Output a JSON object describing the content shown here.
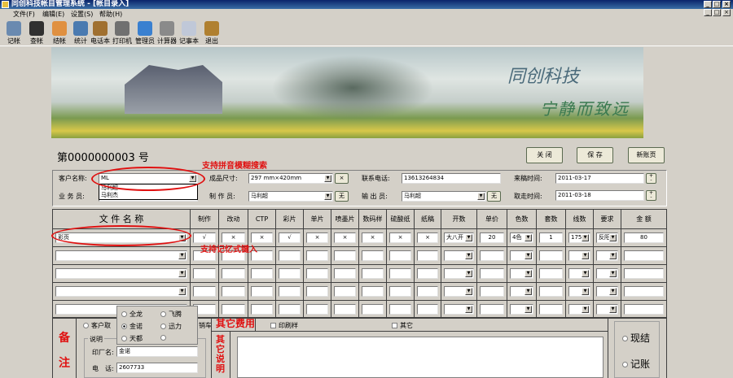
{
  "window": {
    "title": "同创科技帐目管理系统 - [帐目录入]"
  },
  "menu": [
    "文件(F)",
    "编辑(E)",
    "设置(S)",
    "帮助(H)"
  ],
  "toolbar": [
    {
      "label": "记帐",
      "icon": "ledger-icon",
      "color": "#6a8ab0"
    },
    {
      "label": "查帐",
      "icon": "search-icon",
      "color": "#303030"
    },
    {
      "label": "结帐",
      "icon": "checkout-icon",
      "color": "#e09040"
    },
    {
      "label": "统计",
      "icon": "tools-icon",
      "color": "#4a7ab0"
    },
    {
      "label": "电话本",
      "icon": "phonebook-icon",
      "color": "#a07030"
    },
    {
      "label": "打印机",
      "icon": "printer-icon",
      "color": "#707070"
    },
    {
      "label": "管理员",
      "icon": "users-icon",
      "color": "#3a80d0"
    },
    {
      "label": "计算器",
      "icon": "calculator-icon",
      "color": "#8a8a8a"
    },
    {
      "label": "记事本",
      "icon": "notepad-icon",
      "color": "#c0c8d8"
    },
    {
      "label": "退出",
      "icon": "exit-icon",
      "color": "#b08030"
    }
  ],
  "banner": {
    "text1": "同创科技",
    "text2": "宁静而致远"
  },
  "doc": {
    "number": "第0000000003 号"
  },
  "buttons": {
    "close": "关 闭",
    "save": "保 存",
    "new": "新账页"
  },
  "form": {
    "customer_label": "客户名称:",
    "customer_value": "ML",
    "customer_suggestions": [
      "马利超",
      "马利杰"
    ],
    "size_label": "成品尺寸:",
    "size_value": "297 mm×420mm",
    "size_btn": "×",
    "phone_label": "联系电话:",
    "phone_value": "13613264834",
    "arrive_label": "来稿时间:",
    "arrive_value": "2011-03-17",
    "sales_label": "业 务 员:",
    "maker_label": "制 作 员:",
    "maker_value": "马利超",
    "maker_btn": "无",
    "output_label": "输 出 员:",
    "output_value": "马利超",
    "output_btn": "无",
    "pickup_label": "取走时间:",
    "pickup_value": "2011-03-18"
  },
  "annotations": {
    "pinyin": "支持拼音模糊搜索",
    "memory": "支持记忆式键入"
  },
  "table": {
    "headers": [
      "文 件 名 称",
      "制作",
      "改动",
      "CTP",
      "彩片",
      "单片",
      "喷墨片",
      "数码样",
      "硫酸纸",
      "纸稿",
      "开数",
      "单价",
      "色数",
      "套数",
      "线数",
      "要求",
      "金 额"
    ],
    "rows": [
      [
        "彩页",
        "√",
        "×",
        "×",
        "√",
        "×",
        "×",
        "×",
        "×",
        "×",
        "大八开",
        "20",
        "4色",
        "1",
        "175线",
        "反阳",
        "80"
      ],
      [
        "",
        "",
        "",
        "",
        "",
        "",
        "",
        "",
        "",
        "",
        "",
        "",
        "",
        "",
        "",
        "",
        ""
      ],
      [
        "",
        "",
        "",
        "",
        "",
        "",
        "",
        "",
        "",
        "",
        "",
        "",
        "",
        "",
        "",
        "",
        ""
      ],
      [
        "",
        "",
        "",
        "",
        "",
        "",
        "",
        "",
        "",
        "",
        "",
        "",
        "",
        "",
        "",
        "",
        ""
      ],
      [
        "",
        "",
        "",
        "",
        "",
        "",
        "",
        "",
        "",
        "",
        "",
        "",
        "",
        "",
        "",
        "",
        ""
      ]
    ]
  },
  "remarks": {
    "title1": "备",
    "title2": "注",
    "customer_radio": "客户取",
    "delivery_fragment": "销车",
    "group_label": "说明",
    "factory_label": "印厂名:",
    "factory_value": "金诺",
    "phone_label": "电　话:",
    "phone_value": "2607733",
    "popup_options": [
      "全龙",
      "飞腾",
      "金诺",
      "迅力",
      "天都",
      ""
    ],
    "popup_selected": 2
  },
  "other": {
    "fee_title": "其它费用",
    "print_sample": "印刷样",
    "other": "其它",
    "desc_title": [
      "其",
      "它",
      "说",
      "明"
    ]
  },
  "settle": {
    "cash": "现结",
    "account": "记账"
  }
}
